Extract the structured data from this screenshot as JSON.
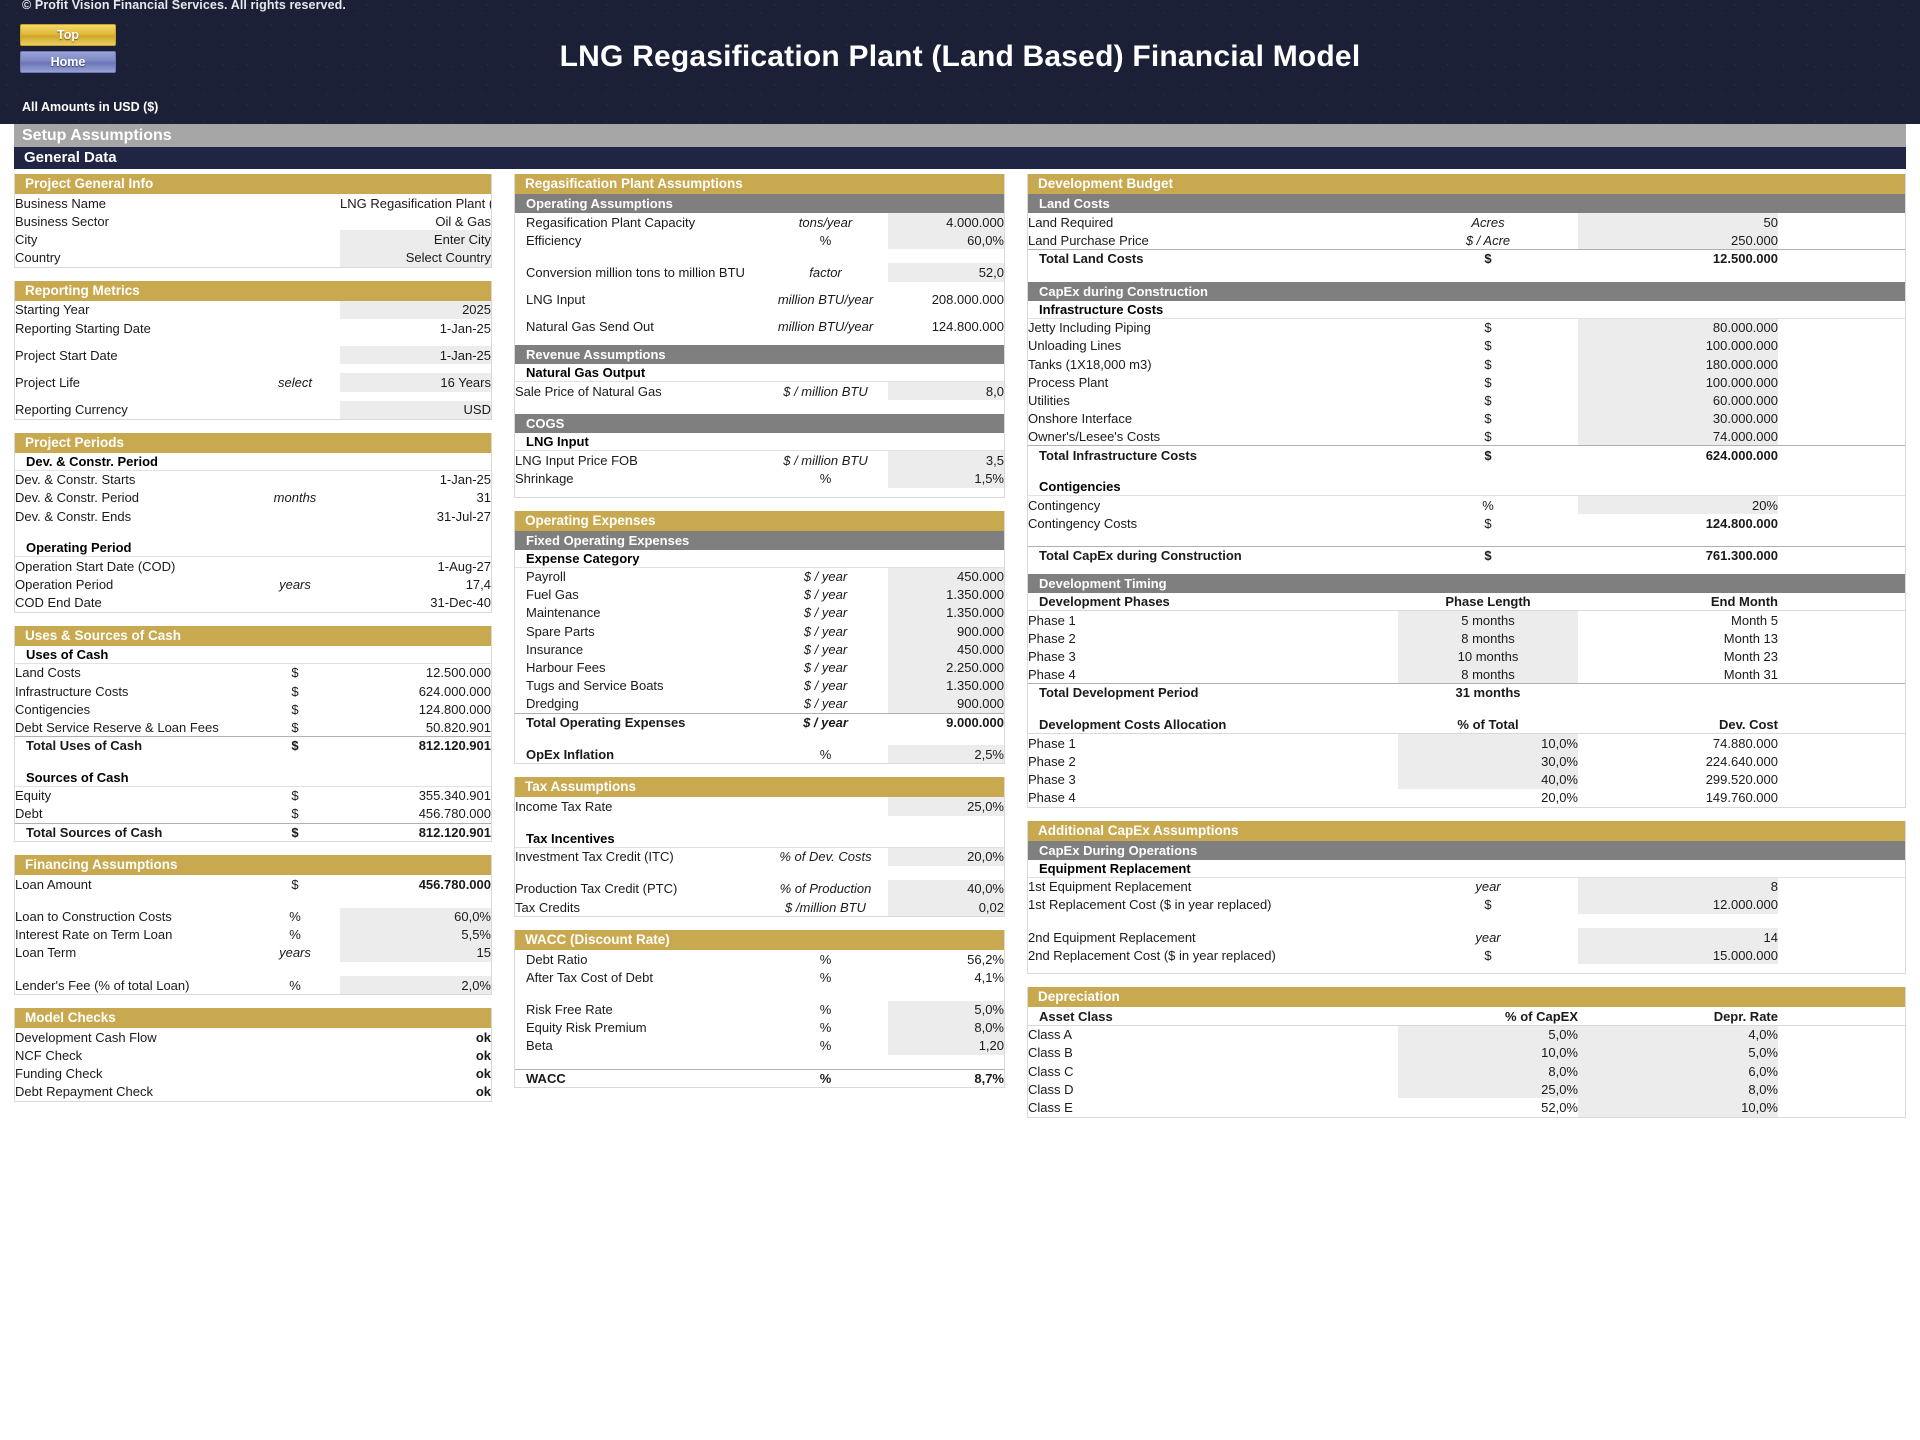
{
  "banner": {
    "copyright": "© Profit Vision Financial Services. All rights reserved.",
    "btn_top": "Top",
    "btn_home": "Home",
    "title": "LNG Regasification Plant (Land Based) Financial Model",
    "amounts": "All Amounts in  USD ($)"
  },
  "page": {
    "setup_title": "Setup Assumptions",
    "general_title": "General Data"
  },
  "project_general_info": {
    "title": "Project General Info",
    "rows": [
      {
        "label": "Business Name",
        "unit": "",
        "value": "LNG Regasification Plant (Land Based)"
      },
      {
        "label": "Business Sector",
        "unit": "",
        "value": "Oil & Gas"
      },
      {
        "label": "City",
        "unit": "",
        "value": "Enter City"
      },
      {
        "label": "Country",
        "unit": "",
        "value": "Select Country"
      }
    ]
  },
  "reporting_metrics": {
    "title": "Reporting Metrics",
    "rows": [
      {
        "label": "Starting Year",
        "unit": "",
        "value": "2025"
      },
      {
        "label": "Reporting Starting Date",
        "unit": "",
        "value": "1-Jan-25"
      },
      {
        "label": "Project Start Date",
        "unit": "",
        "value": "1-Jan-25"
      },
      {
        "label": "Project Life",
        "unit": "select",
        "value": "16 Years"
      },
      {
        "label": "Reporting Currency",
        "unit": "",
        "value": "USD"
      }
    ]
  },
  "project_periods": {
    "title": "Project Periods",
    "dev_header": "Dev. & Constr. Period",
    "dev_rows": [
      {
        "label": "Dev. & Constr. Starts",
        "unit": "",
        "value": "1-Jan-25"
      },
      {
        "label": "Dev. & Constr. Period",
        "unit": "months",
        "value": "31"
      },
      {
        "label": "Dev. & Constr. Ends",
        "unit": "",
        "value": "31-Jul-27"
      }
    ],
    "op_header": "Operating Period",
    "op_rows": [
      {
        "label": "Operation Start Date (COD)",
        "unit": "",
        "value": "1-Aug-27"
      },
      {
        "label": "Operation Period",
        "unit": "years",
        "value": "17,4"
      },
      {
        "label": "COD End Date",
        "unit": "",
        "value": "31-Dec-40"
      }
    ]
  },
  "uses_sources": {
    "title": "Uses & Sources of Cash",
    "uses_header": "Uses of Cash",
    "uses_rows": [
      {
        "label": "Land Costs",
        "unit": "$",
        "value": "12.500.000"
      },
      {
        "label": "Infrastructure Costs",
        "unit": "$",
        "value": "624.000.000"
      },
      {
        "label": "Contigencies",
        "unit": "$",
        "value": "124.800.000"
      },
      {
        "label": "Debt Service Reserve & Loan Fees",
        "unit": "$",
        "value": "50.820.901"
      }
    ],
    "uses_total": {
      "label": "Total Uses of Cash",
      "unit": "$",
      "value": "812.120.901"
    },
    "sources_header": "Sources of Cash",
    "sources_rows": [
      {
        "label": "Equity",
        "unit": "$",
        "value": "355.340.901"
      },
      {
        "label": "Debt",
        "unit": "$",
        "value": "456.780.000"
      }
    ],
    "sources_total": {
      "label": "Total Sources of Cash",
      "unit": "$",
      "value": "812.120.901"
    }
  },
  "financing": {
    "title": "Financing Assumptions",
    "loan_amount": {
      "label": "Loan Amount",
      "unit": "$",
      "value": "456.780.000"
    },
    "rows": [
      {
        "label": "Loan to Construction Costs",
        "unit": "%",
        "value": "60,0%"
      },
      {
        "label": "Interest Rate on Term Loan",
        "unit": "%",
        "value": "5,5%"
      },
      {
        "label": "Loan Term",
        "unit": "years",
        "value": "15"
      }
    ],
    "lender_fee": {
      "label": "Lender's Fee (% of total Loan)",
      "unit": "%",
      "value": "2,0%"
    }
  },
  "model_checks": {
    "title": "Model Checks",
    "rows": [
      {
        "label": "Development Cash Flow",
        "value": "ok"
      },
      {
        "label": "NCF Check",
        "value": "ok"
      },
      {
        "label": "Funding Check",
        "value": "ok"
      },
      {
        "label": "Debt Repayment Check",
        "value": "ok"
      }
    ]
  },
  "regas": {
    "title": "Regasification Plant Assumptions",
    "operating_header": "Operating Assumptions",
    "operating_rows": [
      {
        "label": "Regasification Plant Capacity",
        "unit": "tons/year",
        "value": "4.000.000"
      },
      {
        "label": "Efficiency",
        "unit": "%",
        "value": "60,0%"
      },
      {
        "label": "Conversion million tons to million BTU",
        "unit": "factor",
        "value": "52,0"
      },
      {
        "label": "LNG Input",
        "unit": "million BTU/year",
        "value": "208.000.000"
      },
      {
        "label": "Natural Gas Send Out",
        "unit": "million BTU/year",
        "value": "124.800.000"
      }
    ],
    "revenue_header": "Revenue Assumptions",
    "revenue_sub": "Natural Gas Output",
    "revenue_rows": [
      {
        "label": "Sale Price of Natural Gas",
        "unit": "$ / million BTU",
        "value": "8,0"
      }
    ],
    "cogs_header": "COGS",
    "cogs_sub": "LNG Input",
    "cogs_rows": [
      {
        "label": "LNG Input Price FOB",
        "unit": "$ / million BTU",
        "value": "3,5"
      },
      {
        "label": "Shrinkage",
        "unit": "%",
        "value": "1,5%"
      }
    ]
  },
  "opex": {
    "title": "Operating Expenses",
    "fixed_header": "Fixed Operating Expenses",
    "category_header": "Expense Category",
    "rows": [
      {
        "label": "Payroll",
        "unit": "$ / year",
        "value": "450.000"
      },
      {
        "label": "Fuel Gas",
        "unit": "$ / year",
        "value": "1.350.000"
      },
      {
        "label": "Maintenance",
        "unit": "$ / year",
        "value": "1.350.000"
      },
      {
        "label": "Spare Parts",
        "unit": "$ / year",
        "value": "900.000"
      },
      {
        "label": "Insurance",
        "unit": "$ / year",
        "value": "450.000"
      },
      {
        "label": "Harbour Fees",
        "unit": "$ / year",
        "value": "2.250.000"
      },
      {
        "label": "Tugs and Service Boats",
        "unit": "$ / year",
        "value": "1.350.000"
      },
      {
        "label": "Dredging",
        "unit": "$ / year",
        "value": "900.000"
      }
    ],
    "total": {
      "label": "Total Operating Expenses",
      "unit": "$ / year",
      "value": "9.000.000"
    },
    "inflation": {
      "label": "OpEx Inflation",
      "unit": "%",
      "value": "2,5%"
    }
  },
  "tax": {
    "title": "Tax Assumptions",
    "income_tax": {
      "label": "Income Tax Rate",
      "unit": "",
      "value": "25,0%"
    },
    "incentives_header": "Tax Incentives",
    "rows": [
      {
        "label": "Investment Tax Credit (ITC)",
        "unit": "% of Dev. Costs",
        "value": "20,0%"
      },
      {
        "label": "Production Tax Credit (PTC)",
        "unit": "% of Production",
        "value": "40,0%"
      },
      {
        "label": "Tax Credits",
        "unit": "$ /million BTU",
        "value": "0,02"
      }
    ]
  },
  "wacc": {
    "title": "WACC (Discount Rate)",
    "rows": [
      {
        "label": "Debt Ratio",
        "unit": "%",
        "value": "56,2%"
      },
      {
        "label": "After Tax Cost of Debt",
        "unit": "%",
        "value": "4,1%"
      },
      {
        "label": "Risk Free Rate",
        "unit": "%",
        "value": "5,0%"
      },
      {
        "label": "Equity Risk Premium",
        "unit": "%",
        "value": "8,0%"
      },
      {
        "label": "Beta",
        "unit": "%",
        "value": "1,20"
      }
    ],
    "total": {
      "label": "WACC",
      "unit": "%",
      "value": "8,7%"
    }
  },
  "dev_budget": {
    "title": "Development Budget",
    "land_header": "Land Costs",
    "land_rows": [
      {
        "label": "Land Required",
        "unit": "Acres",
        "value": "50"
      },
      {
        "label": "Land Purchase Price",
        "unit": "$ / Acre",
        "value": "250.000"
      }
    ],
    "land_total": {
      "label": "Total Land Costs",
      "unit": "$",
      "value": "12.500.000"
    },
    "capex_header": "CapEx during Construction",
    "infra_header": "Infrastructure Costs",
    "infra_rows": [
      {
        "label": "Jetty Including Piping",
        "unit": "$",
        "value": "80.000.000"
      },
      {
        "label": "Unloading Lines",
        "unit": "$",
        "value": "100.000.000"
      },
      {
        "label": "Tanks (1X18,000 m3)",
        "unit": "$",
        "value": "180.000.000"
      },
      {
        "label": "Process Plant",
        "unit": "$",
        "value": "100.000.000"
      },
      {
        "label": "Utilities",
        "unit": "$",
        "value": "60.000.000"
      },
      {
        "label": "Onshore Interface",
        "unit": "$",
        "value": "30.000.000"
      },
      {
        "label": "Owner's/Lesee's Costs",
        "unit": "$",
        "value": "74.000.000"
      }
    ],
    "infra_total": {
      "label": "Total Infrastructure Costs",
      "unit": "$",
      "value": "624.000.000"
    },
    "conting_header": "Contigencies",
    "conting_rows": [
      {
        "label": "Contingency",
        "unit": "%",
        "value": "20%"
      },
      {
        "label": "Contingency Costs",
        "unit": "$",
        "value": "124.800.000"
      }
    ],
    "capex_total": {
      "label": "Total CapEx during Construction",
      "unit": "$",
      "value": "761.300.000"
    }
  },
  "dev_timing": {
    "header": "Development Timing",
    "phases_col1": "Development Phases",
    "phases_col2": "Phase Length",
    "phases_col3": "End Month",
    "phases": [
      {
        "label": "Phase 1",
        "length": "5 months",
        "end": "Month 5"
      },
      {
        "label": "Phase 2",
        "length": "8 months",
        "end": "Month 13"
      },
      {
        "label": "Phase 3",
        "length": "10 months",
        "end": "Month 23"
      },
      {
        "label": "Phase 4",
        "length": "8 months",
        "end": "Month 31"
      }
    ],
    "total": {
      "label": "Total Development Period",
      "length": "31 months",
      "end": ""
    },
    "alloc_col1": "Development Costs Allocation",
    "alloc_col2": "% of Total",
    "alloc_col3": "Dev. Cost",
    "alloc": [
      {
        "label": "Phase 1",
        "pct": "10,0%",
        "cost": "74.880.000"
      },
      {
        "label": "Phase 2",
        "pct": "30,0%",
        "cost": "224.640.000"
      },
      {
        "label": "Phase 3",
        "pct": "40,0%",
        "cost": "299.520.000"
      },
      {
        "label": "Phase 4",
        "pct": "20,0%",
        "cost": "149.760.000"
      }
    ]
  },
  "additional_capex": {
    "title": "Additional CapEx Assumptions",
    "ops_header": "CapEx During Operations",
    "equip_header": "Equipment Replacement",
    "rows": [
      {
        "label": "1st Equipment Replacement",
        "unit": "year",
        "value": "8"
      },
      {
        "label": "1st Replacement Cost  ($ in year replaced)",
        "unit": "$",
        "value": "12.000.000"
      },
      {
        "label": "2nd Equipment Replacement",
        "unit": "year",
        "value": "14"
      },
      {
        "label": "2nd Replacement Cost  ($ in year replaced)",
        "unit": "$",
        "value": "15.000.000"
      }
    ]
  },
  "depreciation": {
    "title": "Depreciation",
    "col1": "Asset Class",
    "col2": "% of CapEX",
    "col3": "Depr. Rate",
    "rows": [
      {
        "label": "Class A",
        "pct": "5,0%",
        "rate": "4,0%"
      },
      {
        "label": "Class B",
        "pct": "10,0%",
        "rate": "5,0%"
      },
      {
        "label": "Class C",
        "pct": "8,0%",
        "rate": "6,0%"
      },
      {
        "label": "Class D",
        "pct": "25,0%",
        "rate": "8,0%"
      },
      {
        "label": "Class E",
        "pct": "52,0%",
        "rate": "10,0%"
      }
    ]
  }
}
